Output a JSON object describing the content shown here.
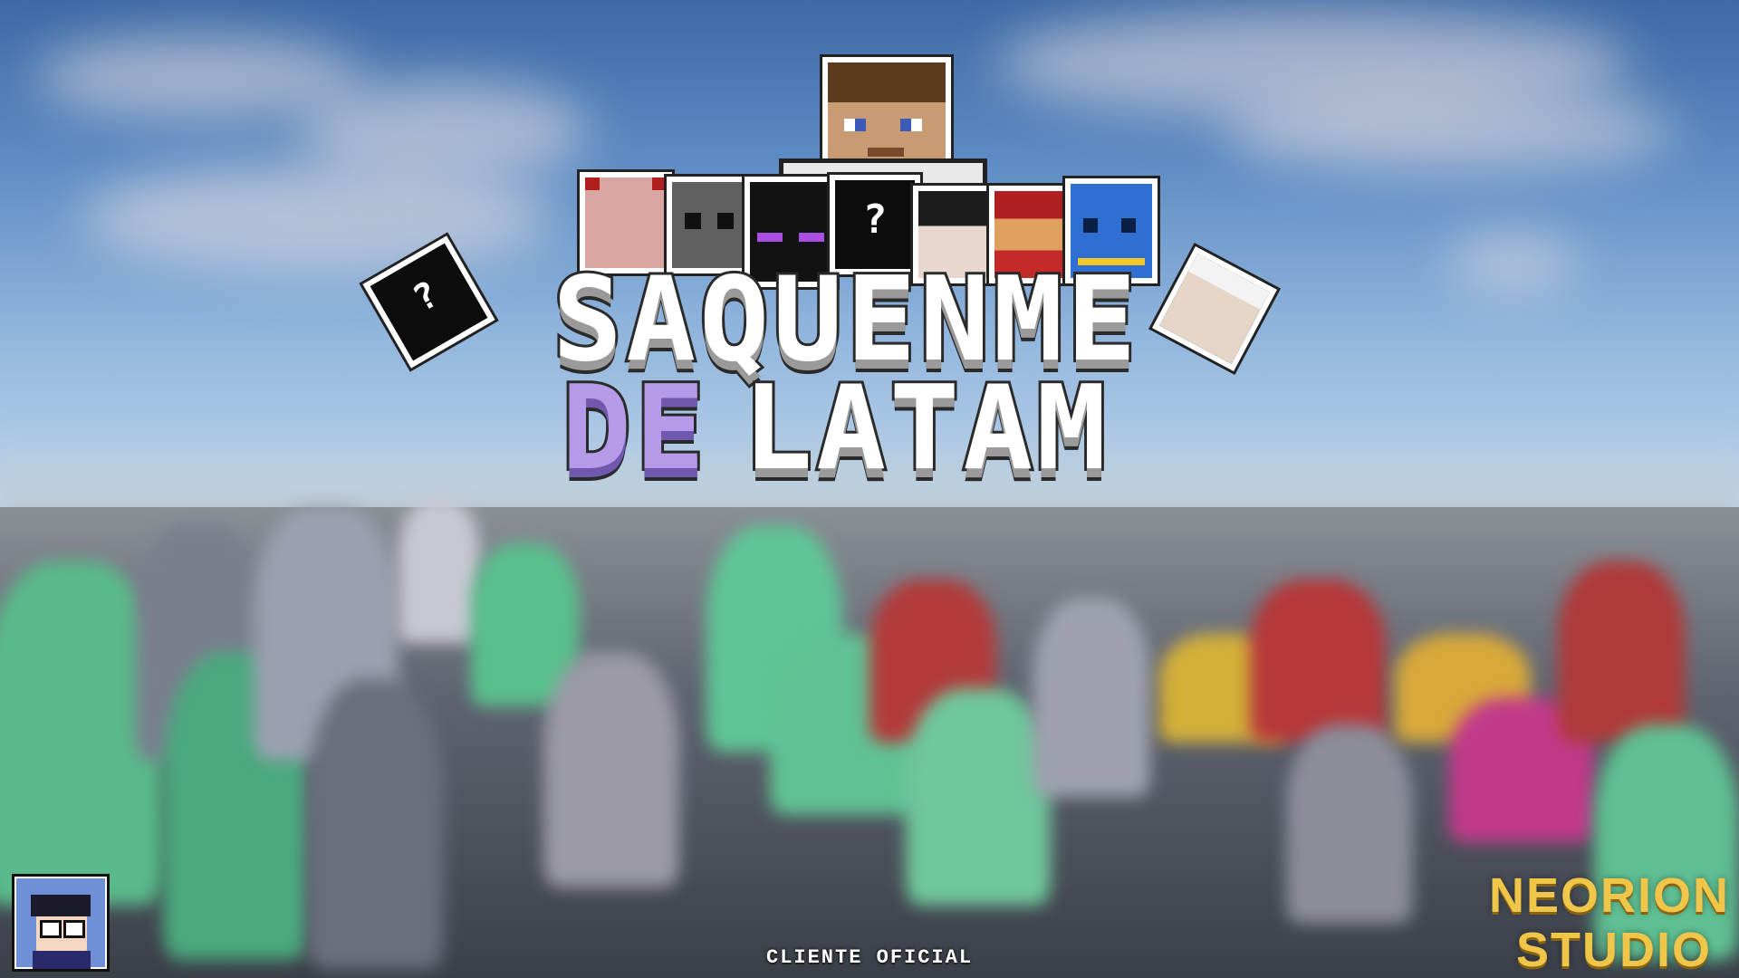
{
  "logo": {
    "line1": "SAQUENME",
    "line2_de": "DE",
    "line2_rest": "LATAM"
  },
  "footer": {
    "client_label": "CLIENTE OFICIAL"
  },
  "brand": {
    "line1": "NEORION",
    "line2": "STUDIO"
  },
  "colors": {
    "brand": "#f0c64a",
    "de_purple": "#b59ae8",
    "logo_white": "#ffffff"
  }
}
